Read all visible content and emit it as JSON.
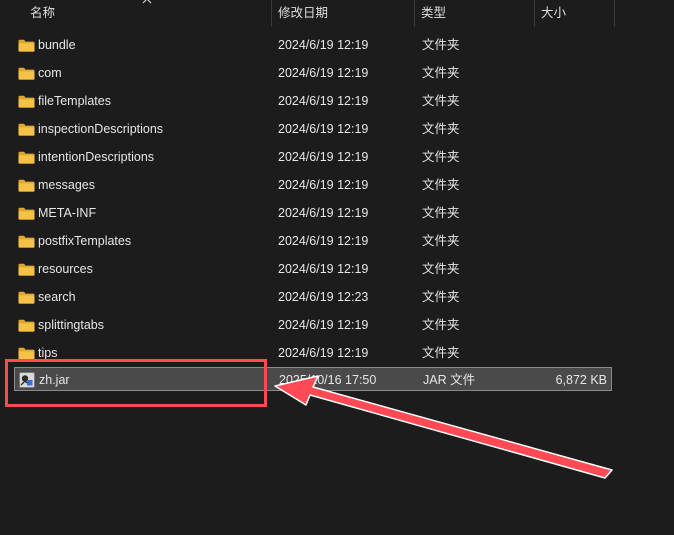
{
  "columns": {
    "name": "名称",
    "date": "修改日期",
    "type": "类型",
    "size": "大小"
  },
  "files": [
    {
      "name": "bundle",
      "date": "2024/6/19 12:19",
      "type": "文件夹",
      "size": "",
      "icon": "folder-icon"
    },
    {
      "name": "com",
      "date": "2024/6/19 12:19",
      "type": "文件夹",
      "size": "",
      "icon": "folder-icon"
    },
    {
      "name": "fileTemplates",
      "date": "2024/6/19 12:19",
      "type": "文件夹",
      "size": "",
      "icon": "folder-icon"
    },
    {
      "name": "inspectionDescriptions",
      "date": "2024/6/19 12:19",
      "type": "文件夹",
      "size": "",
      "icon": "folder-icon"
    },
    {
      "name": "intentionDescriptions",
      "date": "2024/6/19 12:19",
      "type": "文件夹",
      "size": "",
      "icon": "folder-icon"
    },
    {
      "name": "messages",
      "date": "2024/6/19 12:19",
      "type": "文件夹",
      "size": "",
      "icon": "folder-icon"
    },
    {
      "name": "META-INF",
      "date": "2024/6/19 12:19",
      "type": "文件夹",
      "size": "",
      "icon": "folder-icon"
    },
    {
      "name": "postfixTemplates",
      "date": "2024/6/19 12:19",
      "type": "文件夹",
      "size": "",
      "icon": "folder-icon"
    },
    {
      "name": "resources",
      "date": "2024/6/19 12:19",
      "type": "文件夹",
      "size": "",
      "icon": "folder-icon"
    },
    {
      "name": "search",
      "date": "2024/6/19 12:23",
      "type": "文件夹",
      "size": "",
      "icon": "folder-icon"
    },
    {
      "name": "splittingtabs",
      "date": "2024/6/19 12:19",
      "type": "文件夹",
      "size": "",
      "icon": "folder-icon"
    },
    {
      "name": "tips",
      "date": "2024/6/19 12:19",
      "type": "文件夹",
      "size": "",
      "icon": "folder-icon"
    },
    {
      "name": "zh.jar",
      "date": "2025/10/16 17:50",
      "type": "JAR 文件",
      "size": "6,872 KB",
      "icon": "jar-file-icon",
      "selected": true
    }
  ],
  "colors": {
    "background": "#1c1c1c",
    "folder": "#f3c247",
    "selection": "#4a4a4a",
    "annotation": "#ff4a55"
  }
}
